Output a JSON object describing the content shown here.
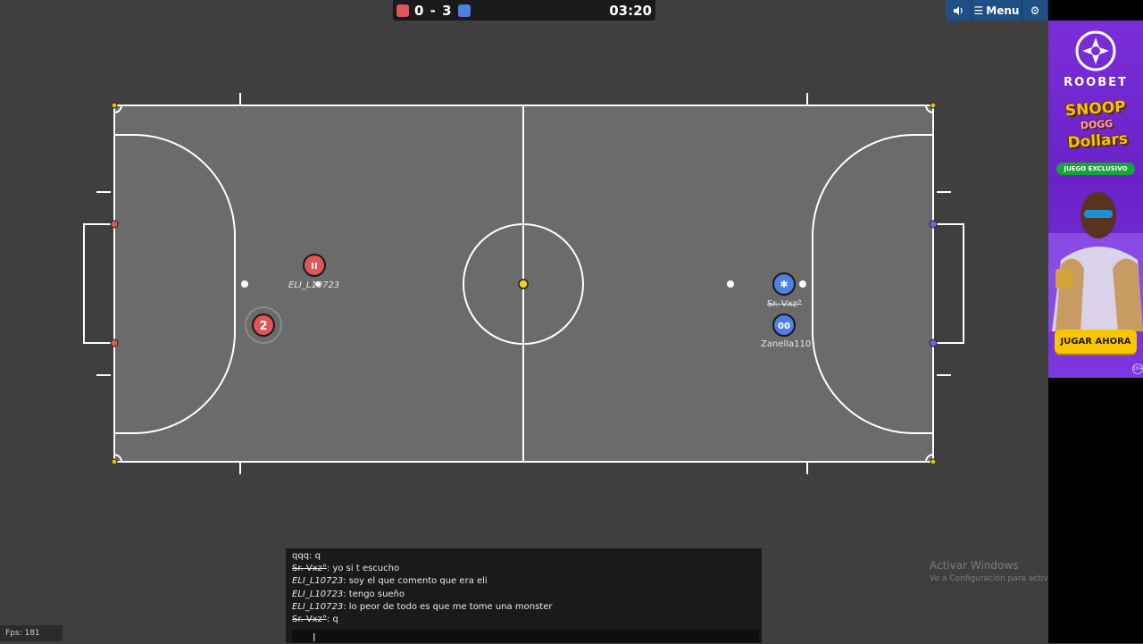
{
  "score": {
    "red_color": "#e05555",
    "blue_color": "#4f7fe0",
    "text": "0 - 3",
    "timer": "03:20"
  },
  "controls": {
    "sound_icon": "speaker-icon",
    "menu_label": "Menu",
    "settings_icon": "gear-icon"
  },
  "players": {
    "red_1": {
      "avatar": "II",
      "name": "ELI_L10723"
    },
    "red_2": {
      "avatar": "2"
    },
    "blue_1": {
      "avatar": "✱",
      "name": "Sr. Vxz°"
    },
    "blue_2": {
      "avatar": "00",
      "name": "Zanella110"
    }
  },
  "chat": {
    "messages": [
      {
        "nick": "qqq",
        "style": "normal",
        "text": "q"
      },
      {
        "nick": "Sr. Vxz°",
        "style": "strike",
        "text": "yo si t escucho"
      },
      {
        "nick": "ELI_L10723",
        "style": "italic",
        "text": "soy el que comento que era eli"
      },
      {
        "nick": "ELI_L10723",
        "style": "italic",
        "text": "tengo sueño"
      },
      {
        "nick": "ELI_L10723",
        "style": "italic",
        "text": "lo peor de todo es que me tome una monster"
      },
      {
        "nick": "Sr. Vxz°",
        "style": "strike",
        "text": "q"
      }
    ],
    "input_value": ""
  },
  "fps": "Fps: 181",
  "windows_watermark": {
    "title": "Activar Windows",
    "subtitle": "Ve a Configuración para activar Windows."
  },
  "ad": {
    "brand": "ROOBET",
    "game_line1": "SNOOP",
    "game_line2": "DOGG",
    "game_line3": "Dollars",
    "badge": "JUEGO EXCLUSIVO",
    "cta": "JUGAR AHORA",
    "age": "18+"
  }
}
